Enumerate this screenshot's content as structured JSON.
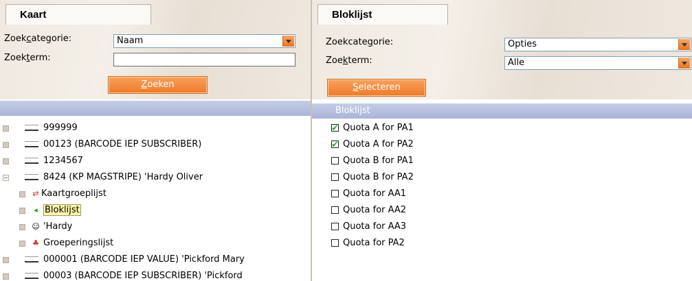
{
  "left": {
    "tab": "Kaart",
    "category_label_pre": "Zoek",
    "category_label_u": "c",
    "category_label_post": "ategorie:",
    "category_value": "Naam",
    "term_label_pre": "Zoek",
    "term_label_u": "t",
    "term_label_post": "erm:",
    "term_value": "",
    "search_button_u": "Z",
    "search_button_rest": "oeken",
    "tree": [
      {
        "text": "999999"
      },
      {
        "text": "00123 (BARCODE IEP SUBSCRIBER)"
      },
      {
        "text": "1234567"
      },
      {
        "text": "8424 (KP MAGSTRIPE) 'Hardy Oliver"
      },
      {
        "text": "Kaartgroeplijst"
      },
      {
        "text": "Bloklijst"
      },
      {
        "text": "'Hardy"
      },
      {
        "text": "Groeperingslijst"
      },
      {
        "text": "000001 (BARCODE IEP VALUE) 'Pickford Mary"
      },
      {
        "text": "00003 (BARCODE IEP SUBSCRIBER) 'Pickford"
      }
    ]
  },
  "right": {
    "tab": "Bloklijst",
    "category_label_pre": "Zoekcate",
    "category_label_u": "g",
    "category_label_post": "orie:",
    "category_value": "Opties",
    "term_label_pre": "Zoe",
    "term_label_u": "k",
    "term_label_post": "term:",
    "term_value": "Alle",
    "select_button_u": "S",
    "select_button_rest": "electeren",
    "list_header": "Bloklijst",
    "items": [
      {
        "label": "Quota A for PA1",
        "checked": true
      },
      {
        "label": "Quota A for PA2",
        "checked": true
      },
      {
        "label": "Quota B for PA1",
        "checked": false
      },
      {
        "label": "Quota B for PA2",
        "checked": false
      },
      {
        "label": "Quota for AA1",
        "checked": false
      },
      {
        "label": "Quota for AA2",
        "checked": false
      },
      {
        "label": "Quota for AA3",
        "checked": false
      },
      {
        "label": "Quota for PA2",
        "checked": false
      }
    ]
  }
}
